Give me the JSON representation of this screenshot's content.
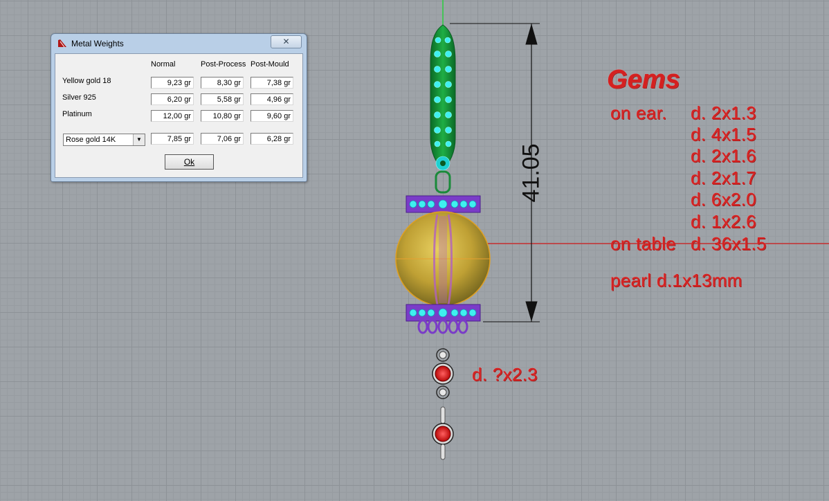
{
  "dialog": {
    "title": "Metal Weights",
    "close_symbol": "✕",
    "columns": [
      "Normal",
      "Post-Process",
      "Post-Mould"
    ],
    "rows": [
      {
        "label": "Yellow gold 18",
        "values": [
          "9,23 gr",
          "8,30 gr",
          "7,38 gr"
        ]
      },
      {
        "label": "Silver 925",
        "values": [
          "6,20 gr",
          "5,58 gr",
          "4,96 gr"
        ]
      },
      {
        "label": "Platinum",
        "values": [
          "12,00 gr",
          "10,80 gr",
          "9,60 gr"
        ]
      }
    ],
    "custom_row": {
      "selected": "Rose gold 14K",
      "values": [
        "7,85 gr",
        "7,06 gr",
        "6,28 gr"
      ]
    },
    "ok_label": "Ok"
  },
  "dimension": {
    "value": "41.05"
  },
  "annotations": {
    "title": "Gems",
    "on_ear_label": "on ear.",
    "on_ear_items": [
      "d. 2x1.3",
      "d. 4x1.5",
      "d. 2x1.6",
      "d. 2x1.7",
      "d. 6x2.0",
      "d. 1x2.6"
    ],
    "on_table_label": "on table",
    "on_table_item": "d. 36x1.5",
    "pearl": "pearl d.1x13mm",
    "small_stone": "d. ?x2.3"
  },
  "colors": {
    "annotation_red": "#d42020",
    "viewport_grid": "#9ea3a8",
    "dialog_frame": "#b9cfe7",
    "gem_cyan": "#3ff0f0",
    "metal_green": "#139a3a",
    "metal_purple": "#7a3cc8",
    "pearl_gold": "#c8a838"
  },
  "icons": [
    "app-icon",
    "close-icon",
    "dropdown-arrow-icon"
  ]
}
